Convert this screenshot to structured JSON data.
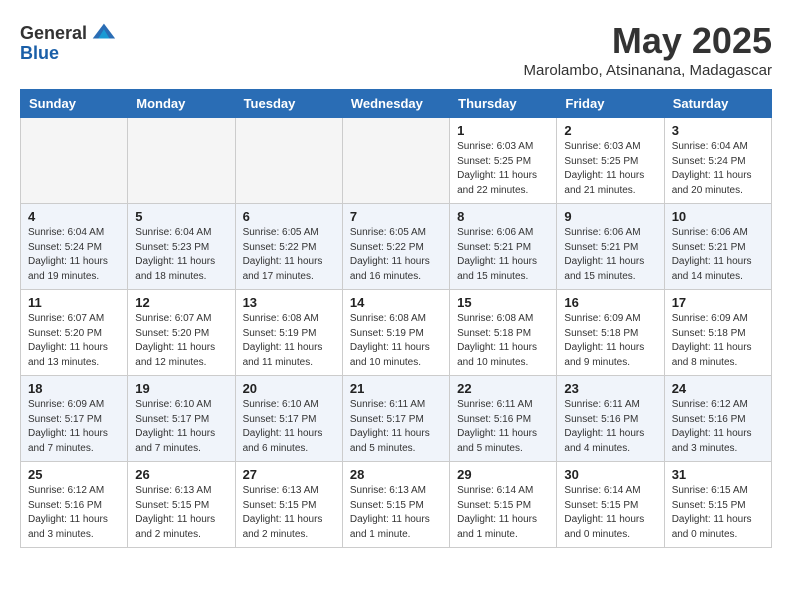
{
  "header": {
    "logo_general": "General",
    "logo_blue": "Blue",
    "month_year": "May 2025",
    "location": "Marolambo, Atsinanana, Madagascar"
  },
  "calendar": {
    "days_of_week": [
      "Sunday",
      "Monday",
      "Tuesday",
      "Wednesday",
      "Thursday",
      "Friday",
      "Saturday"
    ],
    "weeks": [
      [
        {
          "day": "",
          "sunrise": "",
          "sunset": "",
          "daylight": "",
          "empty": true
        },
        {
          "day": "",
          "sunrise": "",
          "sunset": "",
          "daylight": "",
          "empty": true
        },
        {
          "day": "",
          "sunrise": "",
          "sunset": "",
          "daylight": "",
          "empty": true
        },
        {
          "day": "",
          "sunrise": "",
          "sunset": "",
          "daylight": "",
          "empty": true
        },
        {
          "day": "1",
          "sunrise": "6:03 AM",
          "sunset": "5:25 PM",
          "daylight": "11 hours and 22 minutes.",
          "empty": false
        },
        {
          "day": "2",
          "sunrise": "6:03 AM",
          "sunset": "5:25 PM",
          "daylight": "11 hours and 21 minutes.",
          "empty": false
        },
        {
          "day": "3",
          "sunrise": "6:04 AM",
          "sunset": "5:24 PM",
          "daylight": "11 hours and 20 minutes.",
          "empty": false
        }
      ],
      [
        {
          "day": "4",
          "sunrise": "6:04 AM",
          "sunset": "5:24 PM",
          "daylight": "11 hours and 19 minutes.",
          "empty": false
        },
        {
          "day": "5",
          "sunrise": "6:04 AM",
          "sunset": "5:23 PM",
          "daylight": "11 hours and 18 minutes.",
          "empty": false
        },
        {
          "day": "6",
          "sunrise": "6:05 AM",
          "sunset": "5:22 PM",
          "daylight": "11 hours and 17 minutes.",
          "empty": false
        },
        {
          "day": "7",
          "sunrise": "6:05 AM",
          "sunset": "5:22 PM",
          "daylight": "11 hours and 16 minutes.",
          "empty": false
        },
        {
          "day": "8",
          "sunrise": "6:06 AM",
          "sunset": "5:21 PM",
          "daylight": "11 hours and 15 minutes.",
          "empty": false
        },
        {
          "day": "9",
          "sunrise": "6:06 AM",
          "sunset": "5:21 PM",
          "daylight": "11 hours and 15 minutes.",
          "empty": false
        },
        {
          "day": "10",
          "sunrise": "6:06 AM",
          "sunset": "5:21 PM",
          "daylight": "11 hours and 14 minutes.",
          "empty": false
        }
      ],
      [
        {
          "day": "11",
          "sunrise": "6:07 AM",
          "sunset": "5:20 PM",
          "daylight": "11 hours and 13 minutes.",
          "empty": false
        },
        {
          "day": "12",
          "sunrise": "6:07 AM",
          "sunset": "5:20 PM",
          "daylight": "11 hours and 12 minutes.",
          "empty": false
        },
        {
          "day": "13",
          "sunrise": "6:08 AM",
          "sunset": "5:19 PM",
          "daylight": "11 hours and 11 minutes.",
          "empty": false
        },
        {
          "day": "14",
          "sunrise": "6:08 AM",
          "sunset": "5:19 PM",
          "daylight": "11 hours and 10 minutes.",
          "empty": false
        },
        {
          "day": "15",
          "sunrise": "6:08 AM",
          "sunset": "5:18 PM",
          "daylight": "11 hours and 10 minutes.",
          "empty": false
        },
        {
          "day": "16",
          "sunrise": "6:09 AM",
          "sunset": "5:18 PM",
          "daylight": "11 hours and 9 minutes.",
          "empty": false
        },
        {
          "day": "17",
          "sunrise": "6:09 AM",
          "sunset": "5:18 PM",
          "daylight": "11 hours and 8 minutes.",
          "empty": false
        }
      ],
      [
        {
          "day": "18",
          "sunrise": "6:09 AM",
          "sunset": "5:17 PM",
          "daylight": "11 hours and 7 minutes.",
          "empty": false
        },
        {
          "day": "19",
          "sunrise": "6:10 AM",
          "sunset": "5:17 PM",
          "daylight": "11 hours and 7 minutes.",
          "empty": false
        },
        {
          "day": "20",
          "sunrise": "6:10 AM",
          "sunset": "5:17 PM",
          "daylight": "11 hours and 6 minutes.",
          "empty": false
        },
        {
          "day": "21",
          "sunrise": "6:11 AM",
          "sunset": "5:17 PM",
          "daylight": "11 hours and 5 minutes.",
          "empty": false
        },
        {
          "day": "22",
          "sunrise": "6:11 AM",
          "sunset": "5:16 PM",
          "daylight": "11 hours and 5 minutes.",
          "empty": false
        },
        {
          "day": "23",
          "sunrise": "6:11 AM",
          "sunset": "5:16 PM",
          "daylight": "11 hours and 4 minutes.",
          "empty": false
        },
        {
          "day": "24",
          "sunrise": "6:12 AM",
          "sunset": "5:16 PM",
          "daylight": "11 hours and 3 minutes.",
          "empty": false
        }
      ],
      [
        {
          "day": "25",
          "sunrise": "6:12 AM",
          "sunset": "5:16 PM",
          "daylight": "11 hours and 3 minutes.",
          "empty": false
        },
        {
          "day": "26",
          "sunrise": "6:13 AM",
          "sunset": "5:15 PM",
          "daylight": "11 hours and 2 minutes.",
          "empty": false
        },
        {
          "day": "27",
          "sunrise": "6:13 AM",
          "sunset": "5:15 PM",
          "daylight": "11 hours and 2 minutes.",
          "empty": false
        },
        {
          "day": "28",
          "sunrise": "6:13 AM",
          "sunset": "5:15 PM",
          "daylight": "11 hours and 1 minute.",
          "empty": false
        },
        {
          "day": "29",
          "sunrise": "6:14 AM",
          "sunset": "5:15 PM",
          "daylight": "11 hours and 1 minute.",
          "empty": false
        },
        {
          "day": "30",
          "sunrise": "6:14 AM",
          "sunset": "5:15 PM",
          "daylight": "11 hours and 0 minutes.",
          "empty": false
        },
        {
          "day": "31",
          "sunrise": "6:15 AM",
          "sunset": "5:15 PM",
          "daylight": "11 hours and 0 minutes.",
          "empty": false
        }
      ]
    ]
  }
}
